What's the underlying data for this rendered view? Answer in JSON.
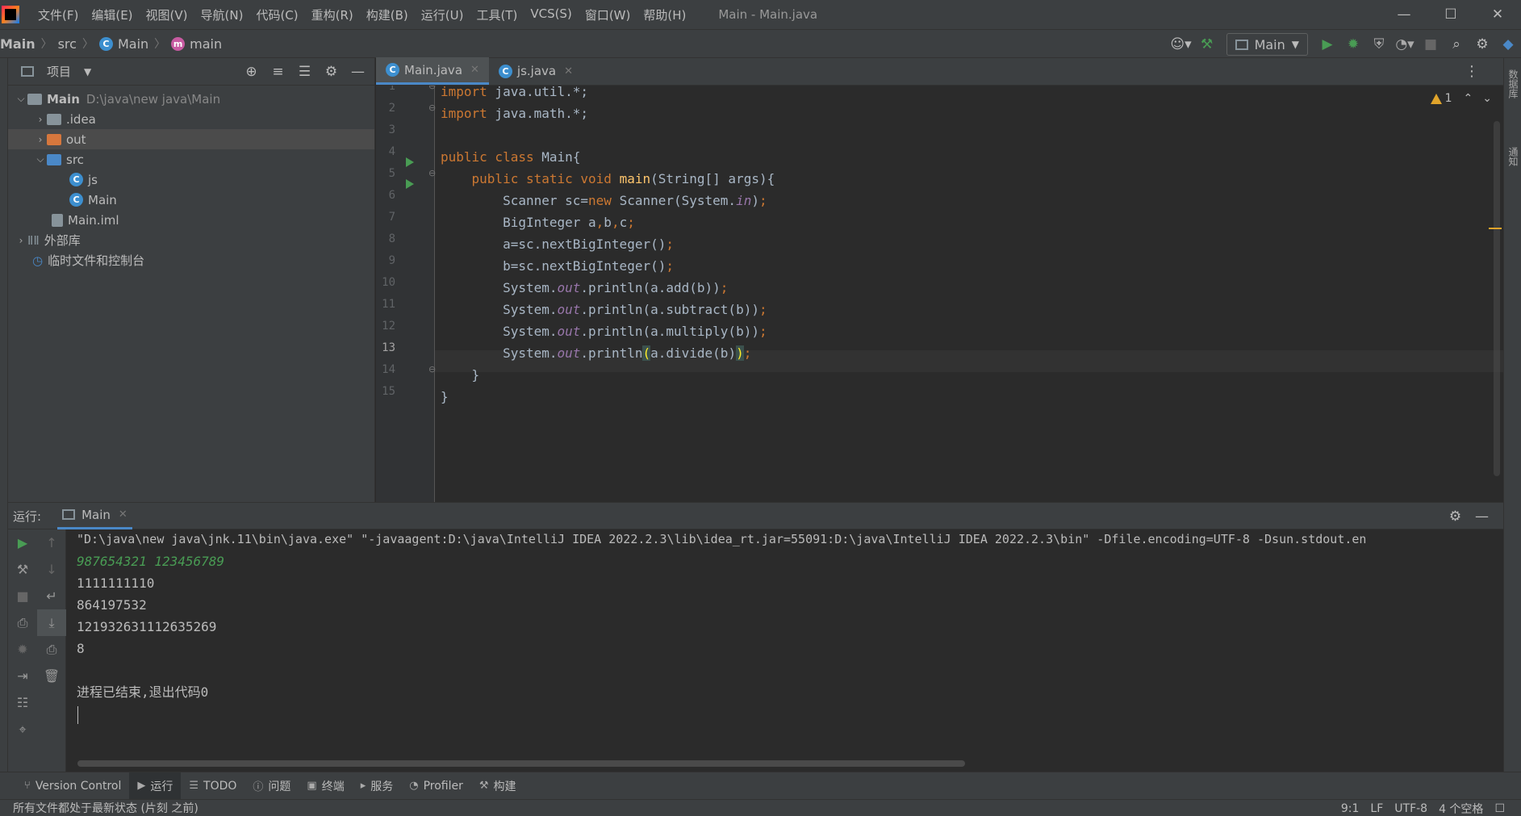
{
  "menubar": {
    "items": [
      "文件(F)",
      "编辑(E)",
      "视图(V)",
      "导航(N)",
      "代码(C)",
      "重构(R)",
      "构建(B)",
      "运行(U)",
      "工具(T)",
      "VCS(S)",
      "窗口(W)",
      "帮助(H)"
    ],
    "window_title": "Main - Main.java"
  },
  "navbar": {
    "crumbs": [
      "Main",
      "src",
      "Main",
      "main"
    ],
    "run_config": "Main"
  },
  "project": {
    "title": "项目",
    "tree": [
      {
        "label": "Main",
        "path": "D:\\java\\new java\\Main"
      },
      {
        "label": ".idea"
      },
      {
        "label": "out"
      },
      {
        "label": "src"
      },
      {
        "label": "js"
      },
      {
        "label": "Main"
      },
      {
        "label": "Main.iml"
      },
      {
        "label": "外部库"
      },
      {
        "label": "临时文件和控制台"
      }
    ]
  },
  "editor": {
    "tabs": [
      "Main.java",
      "js.java"
    ],
    "warnings": "1",
    "line_numbers": [
      "1",
      "2",
      "3",
      "4",
      "5",
      "6",
      "7",
      "8",
      "9",
      "10",
      "11",
      "12",
      "13",
      "14",
      "15"
    ],
    "current_line": "13"
  },
  "run_panel": {
    "label": "运行:",
    "tab": "Main",
    "console": [
      "\"D:\\java\\new java\\jnk.11\\bin\\java.exe\" \"-javaagent:D:\\java\\IntelliJ IDEA 2022.2.3\\lib\\idea_rt.jar=55091:D:\\java\\IntelliJ IDEA 2022.2.3\\bin\" -Dfile.encoding=UTF-8 -Dsun.stdout.en",
      "987654321 123456789",
      "1111111110",
      "864197532",
      "121932631112635269",
      "8",
      "",
      "进程已结束,退出代码0"
    ]
  },
  "toolwindows": [
    "Version Control",
    "运行",
    "TODO",
    "问题",
    "终端",
    "服务",
    "Profiler",
    "构建"
  ],
  "status": {
    "message": "所有文件都处于最新状态 (片刻 之前)",
    "position": "9:1",
    "line_sep": "LF",
    "encoding": "UTF-8",
    "indent": "4 个空格"
  },
  "right_strip": {
    "labels": [
      "数据库",
      "通知"
    ]
  },
  "colors": {
    "keyword": "#cc7832",
    "method": "#ffc66d",
    "field": "#9876aa",
    "text": "#a9b7c6",
    "accent": "#4a88c7",
    "run_green": "#499c54"
  }
}
